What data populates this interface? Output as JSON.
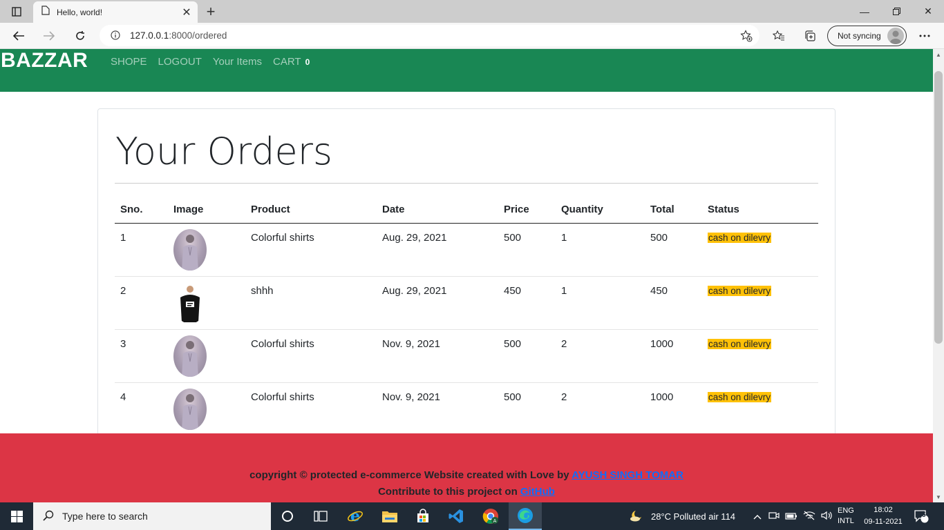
{
  "browser": {
    "tab_title": "Hello, world!",
    "url_host": "127.0.0.1",
    "url_path": ":8000/ordered",
    "sync_label": "Not syncing"
  },
  "nav": {
    "brand": "BAZZAR",
    "links": [
      "SHOPE",
      "LOGOUT",
      "Your Items",
      "CART"
    ],
    "cart_count": "0"
  },
  "orders": {
    "heading": "Your Orders",
    "columns": [
      "Sno.",
      "Image",
      "Product",
      "Date",
      "Price",
      "Quantity",
      "Total",
      "Status"
    ],
    "rows": [
      {
        "sno": "1",
        "image": "purple-shirt",
        "product": "Colorful shirts",
        "date": "Aug. 29, 2021",
        "price": "500",
        "quantity": "1",
        "total": "500",
        "status": "cash on dilevry"
      },
      {
        "sno": "2",
        "image": "black-tshirt",
        "product": "shhh",
        "date": "Aug. 29, 2021",
        "price": "450",
        "quantity": "1",
        "total": "450",
        "status": "cash on dilevry"
      },
      {
        "sno": "3",
        "image": "purple-shirt",
        "product": "Colorful shirts",
        "date": "Nov. 9, 2021",
        "price": "500",
        "quantity": "2",
        "total": "1000",
        "status": "cash on dilevry"
      },
      {
        "sno": "4",
        "image": "purple-shirt",
        "product": "Colorful shirts",
        "date": "Nov. 9, 2021",
        "price": "500",
        "quantity": "2",
        "total": "1000",
        "status": "cash on dilevry"
      }
    ]
  },
  "footer": {
    "line1_text": "copyright © protected e-commerce Website created with Love by ",
    "line1_link": "AYUSH SINGH TOMAR",
    "line2_text": "Contribute to this project on ",
    "line2_link": "GitHub"
  },
  "taskbar": {
    "search_placeholder": "Type here to search",
    "weather": "28°C  Polluted air 114",
    "lang1": "ENG",
    "lang2": "INTL",
    "time": "18:02",
    "date": "09-11-2021",
    "notifications": "5"
  },
  "colors": {
    "navbar": "#198754",
    "footer": "#dc3545",
    "status_mark": "#ffc107"
  }
}
